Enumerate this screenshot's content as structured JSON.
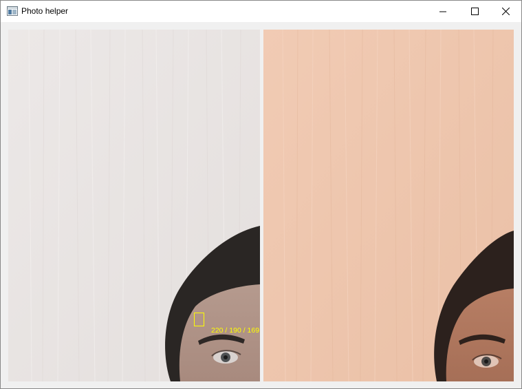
{
  "window": {
    "title": "Photo helper",
    "app_icon": "app-window-icon",
    "controls": {
      "minimize_icon": "minimize-icon",
      "maximize_icon": "maximize-icon",
      "close_icon": "close-icon"
    }
  },
  "panels": {
    "left": {
      "content": "photo-original",
      "sample_readout": "220 / 190 / 169",
      "sample_color": "#ffff00"
    },
    "right": {
      "content": "photo-adjusted"
    }
  },
  "colors": {
    "left_background": "#e9e4e2",
    "right_background": "#eec6ae",
    "window_bg": "#f0f0f0",
    "titlebar_bg": "#ffffff"
  }
}
